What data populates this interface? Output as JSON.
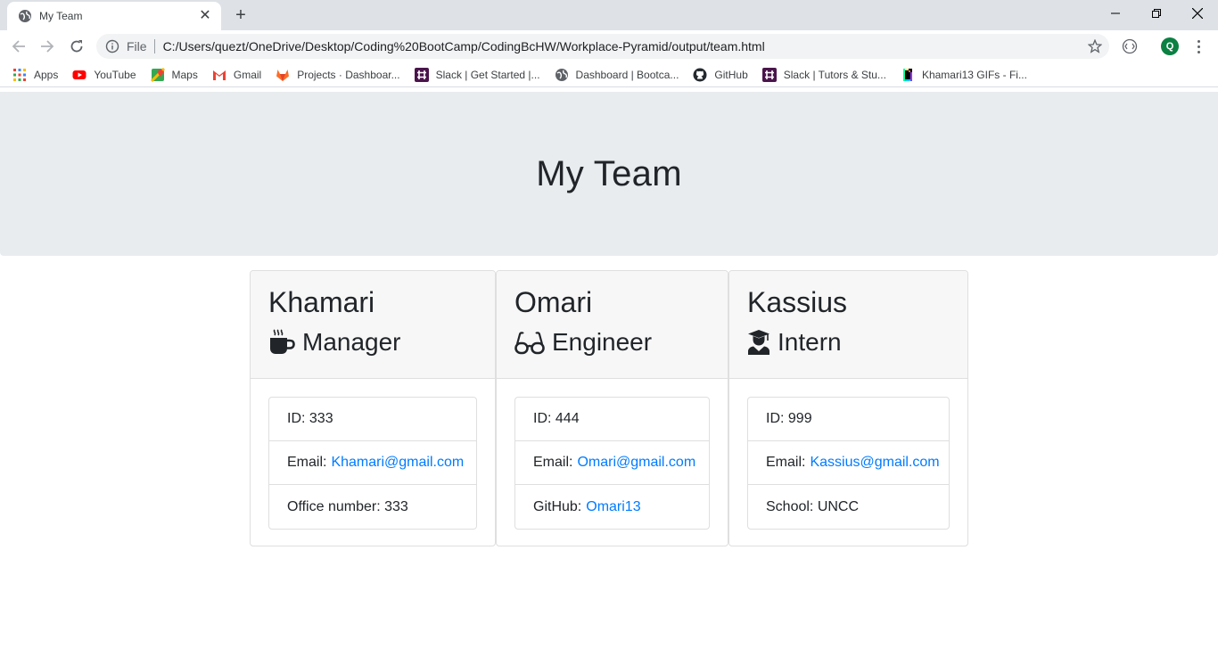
{
  "browser": {
    "tab_title": "My Team",
    "new_tab": "+",
    "address_scheme": "File",
    "address_url": "C:/Users/quezt/OneDrive/Desktop/Coding%20BootCamp/CodingBcHW/Workplace-Pyramid/output/team.html",
    "profile_initial": "Q",
    "bookmarks": [
      {
        "label": "Apps",
        "icon": "apps-grid-icon",
        "color": "#4285f4"
      },
      {
        "label": "YouTube",
        "icon": "youtube-icon",
        "color": "#ff0000"
      },
      {
        "label": "Maps",
        "icon": "maps-icon",
        "color": "#34a853"
      },
      {
        "label": "Gmail",
        "icon": "gmail-icon",
        "color": "#ea4335"
      },
      {
        "label": "Projects · Dashboar...",
        "icon": "gitlab-icon",
        "color": "#fc6d26"
      },
      {
        "label": "Slack | Get Started |...",
        "icon": "slack-icon",
        "color": "#4a154b"
      },
      {
        "label": "Dashboard | Bootca...",
        "icon": "globe-icon",
        "color": "#5f6368"
      },
      {
        "label": "GitHub",
        "icon": "github-icon",
        "color": "#24292e"
      },
      {
        "label": "Slack | Tutors & Stu...",
        "icon": "slack-icon",
        "color": "#4a154b"
      },
      {
        "label": "Khamari13 GIFs - Fi...",
        "icon": "giphy-icon",
        "color": "#000000"
      }
    ]
  },
  "page": {
    "title": "My Team",
    "link_color": "#007bff"
  },
  "team": [
    {
      "name": "Khamari",
      "role": "Manager",
      "role_icon": "mug-icon",
      "id_label": "ID: 333",
      "email_label": "Email:",
      "email": "Khamari@gmail.com",
      "extra_label": "Office number: 333",
      "extra_link": ""
    },
    {
      "name": "Omari",
      "role": "Engineer",
      "role_icon": "glasses-icon",
      "id_label": "ID: 444",
      "email_label": "Email:",
      "email": "Omari@gmail.com",
      "extra_label": "GitHub:",
      "extra_link": "Omari13"
    },
    {
      "name": "Kassius",
      "role": "Intern",
      "role_icon": "graduate-icon",
      "id_label": "ID: 999",
      "email_label": "Email:",
      "email": "Kassius@gmail.com",
      "extra_label": "School: UNCC",
      "extra_link": ""
    }
  ]
}
